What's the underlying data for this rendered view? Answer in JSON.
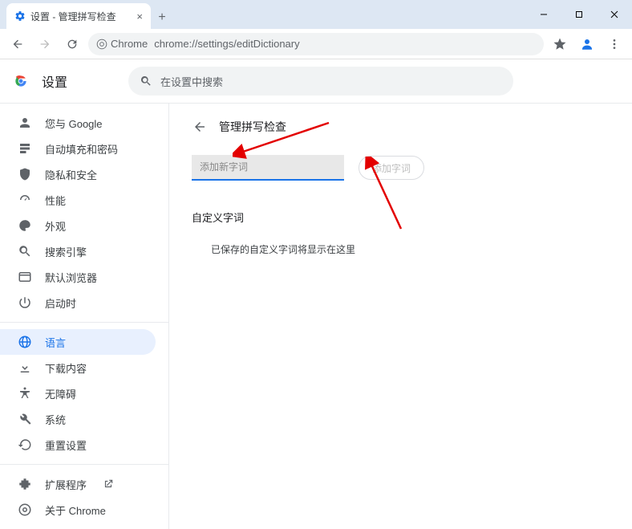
{
  "browser": {
    "tab_title": "设置 - 管理拼写检查",
    "omnibox_chip": "Chrome",
    "url": "chrome://settings/editDictionary"
  },
  "settings": {
    "app_title": "设置",
    "search_placeholder": "在设置中搜索"
  },
  "sidebar": {
    "items": [
      {
        "label": "您与 Google"
      },
      {
        "label": "自动填充和密码"
      },
      {
        "label": "隐私和安全"
      },
      {
        "label": "性能"
      },
      {
        "label": "外观"
      },
      {
        "label": "搜索引擎"
      },
      {
        "label": "默认浏览器"
      },
      {
        "label": "启动时"
      }
    ],
    "items2": [
      {
        "label": "语言"
      },
      {
        "label": "下载内容"
      },
      {
        "label": "无障碍"
      },
      {
        "label": "系统"
      },
      {
        "label": "重置设置"
      }
    ],
    "items3": [
      {
        "label": "扩展程序"
      },
      {
        "label": "关于 Chrome"
      }
    ]
  },
  "panel": {
    "title": "管理拼写检查",
    "input_placeholder": "添加新字词",
    "add_button": "添加字词",
    "section_label": "自定义字词",
    "empty_message": "已保存的自定义字词将显示在这里"
  }
}
